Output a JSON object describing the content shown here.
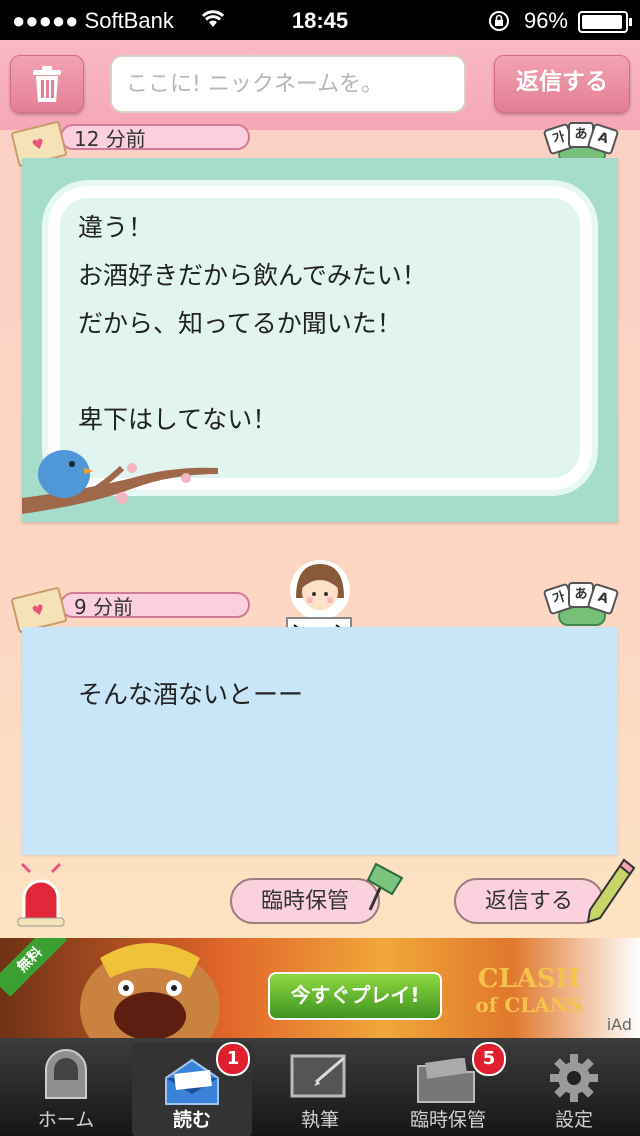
{
  "status_bar": {
    "carrier": "●●●●● SoftBank",
    "time": "18:45",
    "battery_pct": "96%",
    "battery_level": 0.96
  },
  "header": {
    "name_placeholder": "ここに! ニックネームを。",
    "reply_label": "返信する"
  },
  "messages": [
    {
      "time": "12 分前",
      "text": "違う！\nお酒好きだから飲んでみたい！\nだから、知ってるか聞いた！\n\n卑下はしてない！"
    },
    {
      "time": "9 分前",
      "text": "そんな酒ないとーー"
    }
  ],
  "lang_tiles": [
    "가",
    "あ",
    "A"
  ],
  "actions": {
    "temp_save_label": "臨時保管",
    "reply_label": "返信する"
  },
  "ad": {
    "free_tag": "無料",
    "cta": "今すぐプレイ!",
    "logo_line1": "CLASH",
    "logo_line2": "of CLANS",
    "iad": "iAd"
  },
  "tabs": [
    {
      "label": "ホーム",
      "icon": "mailbox-icon"
    },
    {
      "label": "読む",
      "icon": "open-mail-icon",
      "badge": "1"
    },
    {
      "label": "執筆",
      "icon": "write-icon"
    },
    {
      "label": "臨時保管",
      "icon": "folder-icon",
      "badge": "5"
    },
    {
      "label": "設定",
      "icon": "gear-icon"
    }
  ]
}
